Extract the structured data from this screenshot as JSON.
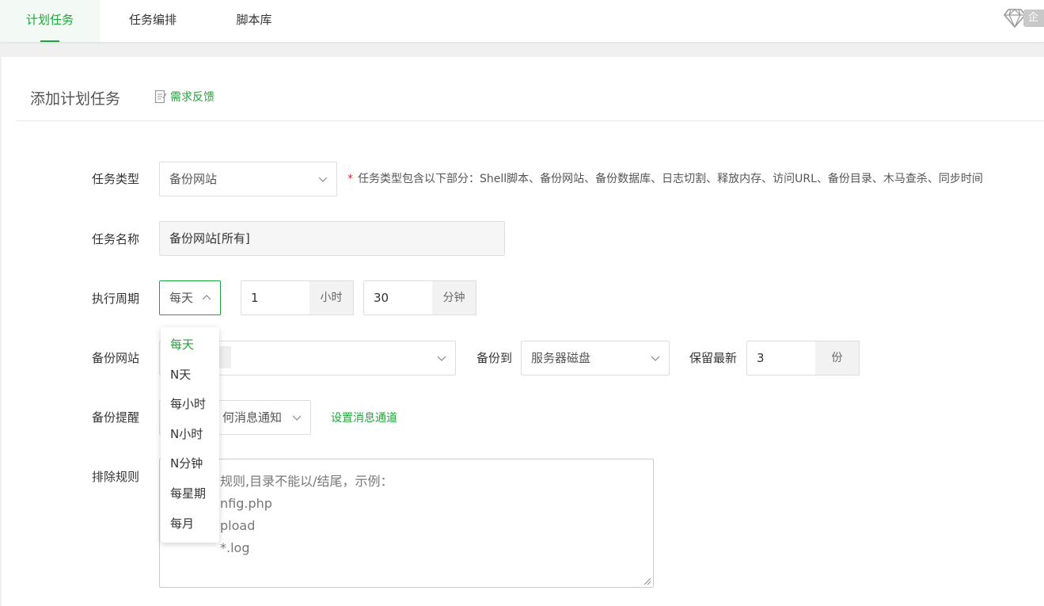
{
  "tabs": [
    {
      "label": "计划任务",
      "active": true
    },
    {
      "label": "任务编排",
      "active": false
    },
    {
      "label": "脚本库",
      "active": false
    }
  ],
  "vip_badge": "企",
  "page": {
    "title": "添加计划任务",
    "feedback_label": "需求反馈"
  },
  "form": {
    "task_type_label": "任务类型",
    "task_type_value": "备份网站",
    "task_type_hint": "任务类型包含以下部分：Shell脚本、备份网站、备份数据库、日志切割、释放内存、访问URL、备份目录、木马查杀、同步时间",
    "task_name_label": "任务名称",
    "task_name_value": "备份网站[所有]",
    "period_label": "执行周期",
    "period_value": "每天",
    "hour_value": "1",
    "hour_unit": "小时",
    "minute_value": "30",
    "minute_unit": "分钟",
    "site_label": "备份网站",
    "backup_to_label": "备份到",
    "backup_to_value": "服务器磁盘",
    "keep_label": "保留最新",
    "keep_value": "3",
    "keep_unit": "份",
    "notify_label": "备份提醒",
    "notify_value": "何消息通知",
    "notify_link": "设置消息通道",
    "exclude_label": "排除规则",
    "exclude_text": "规则,目录不能以/结尾，示例：\nnfig.php\npload\n*.log"
  },
  "dropdown": {
    "options": [
      "每天",
      "N天",
      "每小时",
      "N小时",
      "N分钟",
      "每星期",
      "每月"
    ],
    "selected": "每天"
  },
  "colors": {
    "accent": "#20a53a",
    "required": "#ee2222"
  }
}
